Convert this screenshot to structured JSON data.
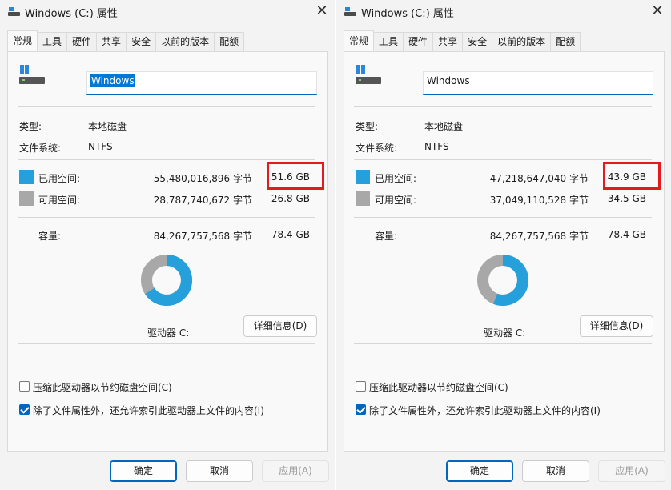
{
  "dialogs": [
    {
      "title": "Windows (C:) 属性",
      "tabs": [
        "常规",
        "工具",
        "硬件",
        "共享",
        "安全",
        "以前的版本",
        "配额"
      ],
      "active_tab": 0,
      "drive_name": "Windows",
      "type_label": "类型:",
      "type_value": "本地磁盘",
      "fs_label": "文件系统:",
      "fs_value": "NTFS",
      "used_label": "已用空间:",
      "used_bytes": "55,480,016,896 字节",
      "used_size": "51.6 GB",
      "free_label": "可用空间:",
      "free_bytes": "28,787,740,672 字节",
      "free_size": "26.8 GB",
      "capacity_label": "容量:",
      "capacity_bytes": "84,267,757,568 字节",
      "capacity_size": "78.4 GB",
      "used_fraction": 0.658,
      "drive_label": "驱动器 C:",
      "details_button": "详细信息(D)",
      "compress_label": "压缩此驱动器以节约磁盘空间(C)",
      "compress_checked": false,
      "index_label": "除了文件属性外，还允许索引此驱动器上文件的内容(I)",
      "index_checked": true,
      "ok_button": "确定",
      "cancel_button": "取消",
      "apply_button": "应用(A)",
      "name_selected": true
    },
    {
      "title": "Windows (C:) 属性",
      "tabs": [
        "常规",
        "工具",
        "硬件",
        "共享",
        "安全",
        "以前的版本",
        "配额"
      ],
      "active_tab": 0,
      "drive_name": "Windows",
      "type_label": "类型:",
      "type_value": "本地磁盘",
      "fs_label": "文件系统:",
      "fs_value": "NTFS",
      "used_label": "已用空间:",
      "used_bytes": "47,218,647,040 字节",
      "used_size": "43.9 GB",
      "free_label": "可用空间:",
      "free_bytes": "37,049,110,528 字节",
      "free_size": "34.5 GB",
      "capacity_label": "容量:",
      "capacity_bytes": "84,267,757,568 字节",
      "capacity_size": "78.4 GB",
      "used_fraction": 0.56,
      "drive_label": "驱动器 C:",
      "details_button": "详细信息(D)",
      "compress_label": "压缩此驱动器以节约磁盘空间(C)",
      "compress_checked": false,
      "index_label": "除了文件属性外，还允许索引此驱动器上文件的内容(I)",
      "index_checked": true,
      "ok_button": "确定",
      "cancel_button": "取消",
      "apply_button": "应用(A)",
      "name_selected": false
    }
  ],
  "colors": {
    "used": "#26a0da",
    "free": "#a8a8a8",
    "highlight": "#e8191d",
    "accent": "#0067c0"
  },
  "icons": [
    "windows-drive-icon",
    "close-icon",
    "checkbox-icon"
  ]
}
